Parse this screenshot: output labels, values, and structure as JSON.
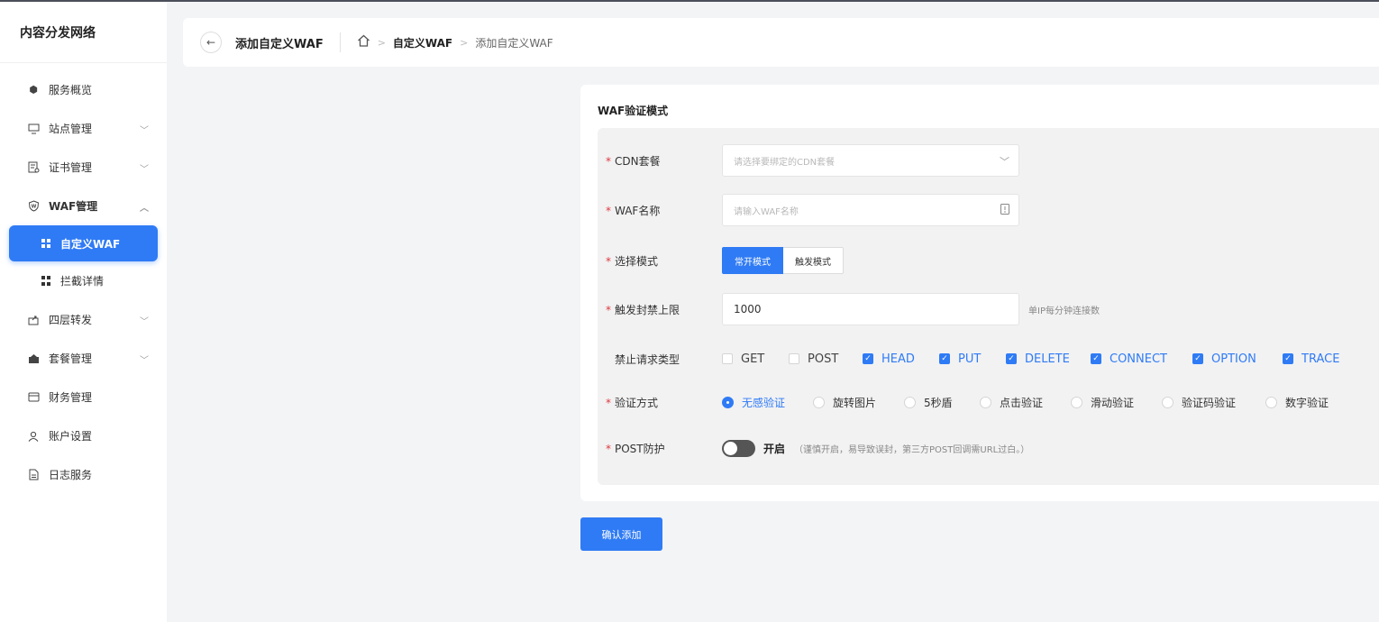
{
  "sidebar": {
    "brand": "内容分发网络",
    "items": [
      {
        "label": "服务概览"
      },
      {
        "label": "站点管理"
      },
      {
        "label": "证书管理"
      },
      {
        "label": "WAF管理"
      },
      {
        "label": "自定义WAF"
      },
      {
        "label": "拦截详情"
      },
      {
        "label": "四层转发"
      },
      {
        "label": "套餐管理"
      },
      {
        "label": "财务管理"
      },
      {
        "label": "账户设置"
      },
      {
        "label": "日志服务"
      }
    ]
  },
  "header": {
    "back_icon": "←",
    "title": "添加自定义WAF",
    "breadcrumb": [
      "自定义WAF",
      "添加自定义WAF"
    ]
  },
  "card": {
    "title": "WAF验证模式",
    "cdn_plan": {
      "label": "CDN套餐",
      "placeholder": "请选择要绑定的CDN套餐"
    },
    "waf_name": {
      "label": "WAF名称",
      "placeholder": "请输入WAF名称"
    },
    "mode": {
      "label": "选择模式",
      "options": [
        "常开模式",
        "触发模式"
      ],
      "selected": "常开模式"
    },
    "limit": {
      "label": "触发封禁上限",
      "value": "1000",
      "hint": "单IP每分钟连接数"
    },
    "methods": {
      "label": "禁止请求类型",
      "options": [
        {
          "name": "GET",
          "checked": false
        },
        {
          "name": "POST",
          "checked": false
        },
        {
          "name": "HEAD",
          "checked": true
        },
        {
          "name": "PUT",
          "checked": true
        },
        {
          "name": "DELETE",
          "checked": true
        },
        {
          "name": "CONNECT",
          "checked": true
        },
        {
          "name": "OPTION",
          "checked": true
        },
        {
          "name": "TRACE",
          "checked": true
        }
      ]
    },
    "verify": {
      "label": "验证方式",
      "options": [
        "无感验证",
        "旋转图片",
        "5秒盾",
        "点击验证",
        "滑动验证",
        "验证码验证",
        "数字验证"
      ],
      "selected": "无感验证"
    },
    "post_protect": {
      "label": "POST防护",
      "toggle_label": "开启",
      "hint": "（谨慎开启，易导致误封，第三方POST回调需URL过白。）"
    }
  },
  "submit_label": "确认添加",
  "colors": {
    "accent": "#2f7bf5",
    "required": "#e0383e"
  }
}
